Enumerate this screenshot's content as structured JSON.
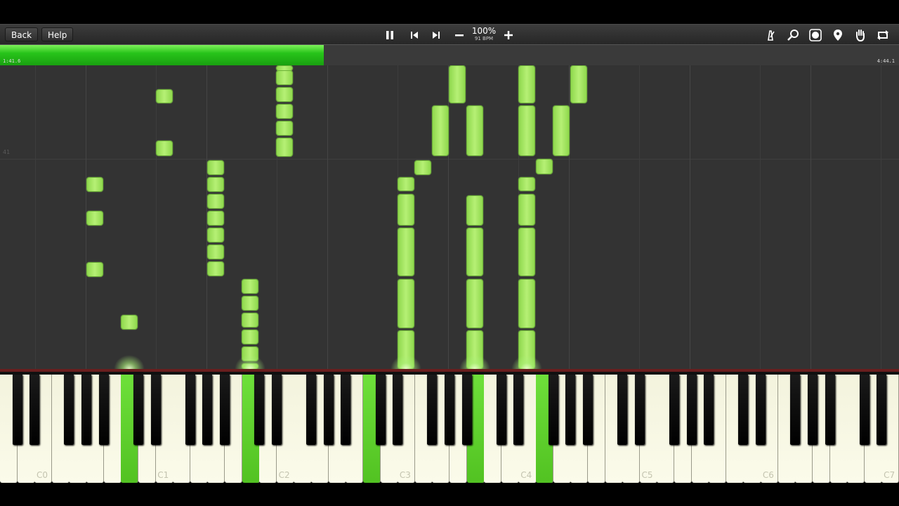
{
  "toolbar": {
    "back_label": "Back",
    "help_label": "Help",
    "zoom": "100%",
    "tempo": "91 BPM",
    "tools": [
      "metronome-icon",
      "search-icon",
      "label-icon",
      "location-pin-icon",
      "hand-icon",
      "loop-icon"
    ]
  },
  "playback": {
    "current_time": "1:41.6",
    "total_time": "4:44.1",
    "progress": 0.36
  },
  "roll": {
    "measure_number": "41",
    "note_color": "#a6e862"
  },
  "keyboard": {
    "octave_labels": [
      "C0",
      "C1",
      "C2",
      "C3",
      "C4",
      "C5",
      "C6",
      "C7"
    ],
    "pressed_color": "#5ed22e"
  }
}
